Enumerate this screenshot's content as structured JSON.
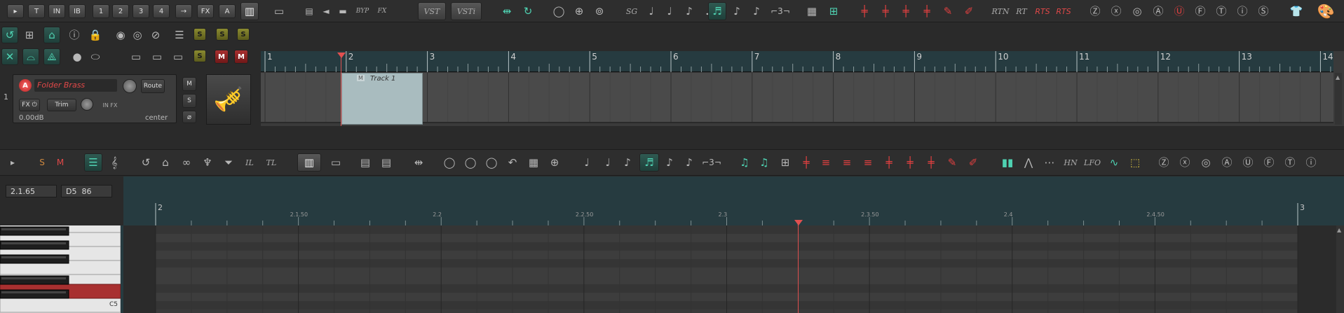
{
  "top_toolbar": {
    "row1_buttons": [
      {
        "label": "▸",
        "name": "play-small-button"
      },
      {
        "label": "T",
        "name": "t-button"
      },
      {
        "label": "IN",
        "name": "in-button"
      },
      {
        "label": "IB",
        "name": "ib-button"
      },
      {
        "label": "1",
        "name": "slot-1-button"
      },
      {
        "label": "2",
        "name": "slot-2-button"
      },
      {
        "label": "3",
        "name": "slot-3-button"
      },
      {
        "label": "4",
        "name": "slot-4-button"
      },
      {
        "label": "→",
        "name": "arrow-right-button"
      },
      {
        "label": "FX",
        "name": "fx-button"
      },
      {
        "label": "A",
        "name": "a-button"
      }
    ],
    "byp_label": "BYP",
    "fx_label": "FX",
    "vst_label": "VST",
    "vsti_label": "VSTi",
    "sg_label": "SG",
    "rtn_label": "RTN",
    "rt_label": "RT",
    "rts_label": "RTS",
    "rts2_label": "RTS"
  },
  "track": {
    "number": "1",
    "name": "Folder Brass",
    "route_label": "Route",
    "fx_label": "FX",
    "trim_label": "Trim",
    "in_fx_label": "IN FX",
    "volume_db": "0.00dB",
    "pan": "center",
    "m_label": "M",
    "s_label": "S"
  },
  "arrange": {
    "measures": [
      "1",
      "2",
      "3",
      "4",
      "5",
      "6",
      "7",
      "8",
      "9",
      "10",
      "11",
      "12",
      "13",
      "14"
    ],
    "item_label": "Track 1",
    "item_m": "M"
  },
  "midi_toolbar": {
    "s_label": "S",
    "m_label": "M",
    "il_label": "IL",
    "tl_label": "TL",
    "hn_label": "HN",
    "lfo_label": "LFO"
  },
  "midi_editor": {
    "position": "2.1.65",
    "note": "D5  86",
    "ruler_major": [
      "2",
      "3"
    ],
    "ruler_minor": [
      "2.1.50",
      "2.2",
      "2.2.50",
      "2.3",
      "2.3.50",
      "2.4",
      "2.4.50"
    ],
    "key_label": "C5"
  },
  "colors": {
    "accent_teal": "#4fd2b2",
    "ruler_bg": "#263b40",
    "item_bg": "#a9bcbf",
    "play_cursor": "#e05050",
    "selected_key": "#a83030"
  }
}
